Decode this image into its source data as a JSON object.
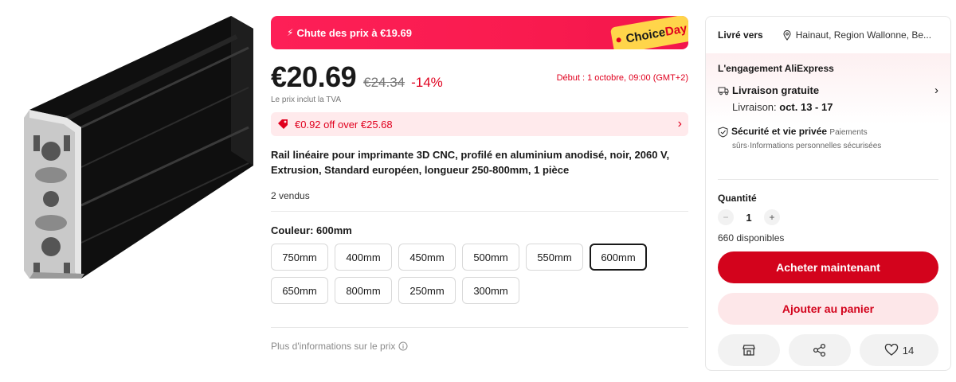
{
  "promo": {
    "text": "Chute des prix à €19.69",
    "badge_prefix": "Choice",
    "badge_suffix": "Day"
  },
  "price": {
    "current": "€20.69",
    "original": "€24.34",
    "discount": "-14%",
    "start_time": "Début : 1 octobre, 09:00 (GMT+2)",
    "vat_note": "Le prix inclut la TVA"
  },
  "coupon": {
    "text": "€0.92 off over €25.68"
  },
  "product": {
    "title": "Rail linéaire pour imprimante 3D CNC, profilé en aluminium anodisé, noir, 2060 V, Extrusion, Standard européen, longueur 250-800mm, 1 pièce",
    "sold": "2 vendus"
  },
  "color": {
    "label": "Couleur: 600mm",
    "options": [
      "750mm",
      "400mm",
      "450mm",
      "500mm",
      "550mm",
      "600mm",
      "650mm",
      "800mm",
      "250mm",
      "300mm"
    ],
    "selected": "600mm"
  },
  "more_info": "Plus d'informations sur le prix",
  "panel": {
    "ship_label": "Livré vers",
    "ship_location": "Hainaut, Region Wallonne, Be...",
    "commitment_title": "L'engagement AliExpress",
    "free_shipping": "Livraison gratuite",
    "delivery_label": "Livraison:",
    "delivery_dates": "oct. 13 - 17",
    "security_title": "Sécurité et vie privée",
    "security_sub1": "Paiements",
    "security_sub2": "sûrs·Informations personnelles sécurisées",
    "quantity_label": "Quantité",
    "quantity_value": "1",
    "quantity_minus": "−",
    "quantity_plus": "+",
    "available": "660 disponibles",
    "buy_now": "Acheter maintenant",
    "add_to_cart": "Ajouter au panier",
    "wishlist_count": "14"
  },
  "icons": {
    "promo": "lightning-icon",
    "coupon": "tag-icon",
    "coupon_arrow": "chevron-right-icon",
    "location": "map-pin-icon",
    "shipping": "truck-icon",
    "security": "shield-check-icon",
    "store": "store-icon",
    "share": "share-icon",
    "wishlist": "heart-icon",
    "info": "info-icon"
  },
  "colors": {
    "accent": "#e0001e",
    "buy_button": "#d3031c",
    "promo_banner": "#fd1f57",
    "choice_badge": "#ffd54a"
  }
}
